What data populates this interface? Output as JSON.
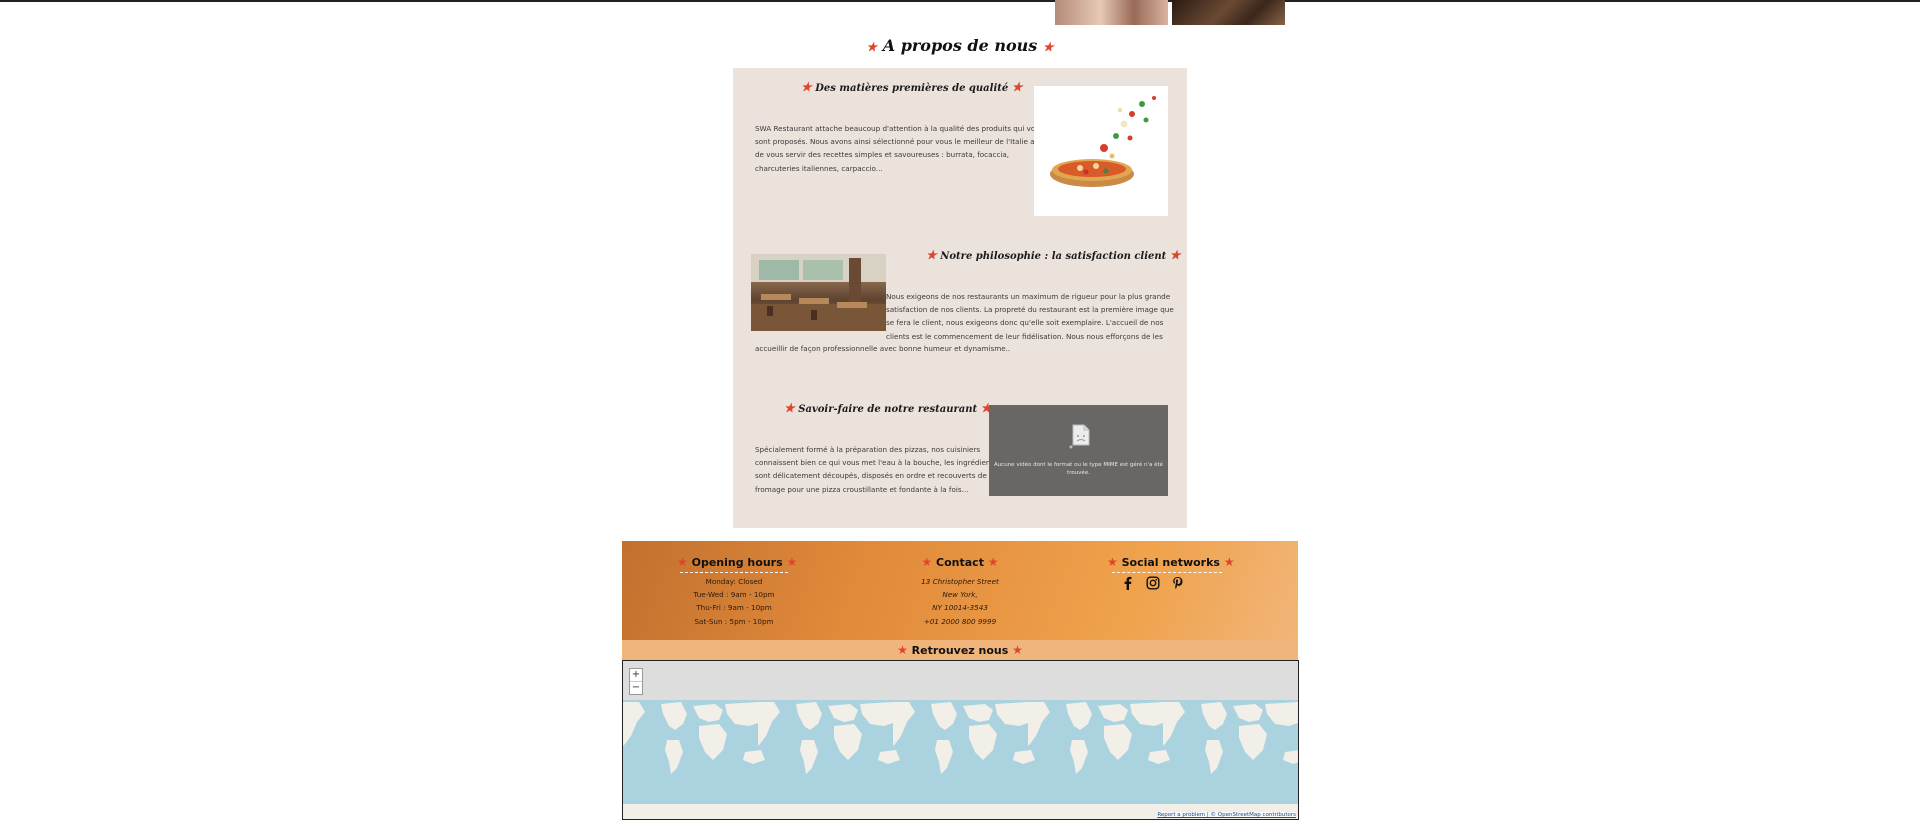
{
  "header": {
    "title": "A propos de nous"
  },
  "about": {
    "sections": [
      {
        "title": "Des matières premières de qualité",
        "lines": [
          "SWA Restaurant attache beaucoup d'attention à la qualité des produits qui vous",
          "sont proposés. Nous avons ainsi sélectionné pour vous le meilleur de l'Italie afin",
          "de vous servir des recettes simples et savoureuses : burrata, focaccia,",
          "charcuteries italiennes, carpaccio..."
        ]
      },
      {
        "title": "Notre philosophie : la satisfaction client",
        "lines": [
          "Nous exigeons de nos restaurants un maximum de rigueur pour la plus grande",
          "satisfaction de nos clients. La propreté du restaurant est la première image que",
          "se fera le client, nous exigeons donc qu'elle soit exemplaire. L'accueil de nos",
          "clients est le commencement de leur fidélisation. Nous nous efforçons de les",
          "accueillir de façon professionnelle avec bonne humeur et dynamisme.."
        ]
      },
      {
        "title": "Savoir-faire de notre restaurant",
        "lines": [
          "Spécialement formé à la préparation des pizzas, nos cuisiniers",
          "connaissent bien ce qui vous met l'eau à la bouche, les ingrédients",
          "sont délicatement découpés, disposés en ordre et recouverts de",
          "fromage pour une pizza croustillante et fondante à la fois..."
        ]
      }
    ],
    "video_error": "Aucune vidéo dont le format ou le type MIME est géré n'a été trouvée."
  },
  "footer": {
    "opening": {
      "title": "Opening hours",
      "lines": [
        "Monday: Closed",
        "Tue-Wed : 9am - 10pm",
        "Thu-Fri : 9am - 10pm",
        "Sat-Sun : 5pm - 10pm"
      ]
    },
    "contact": {
      "title": "Contact",
      "lines": [
        "13 Christopher Street",
        "New York,",
        "NY 10014-3543",
        "+01 2000 800 9999"
      ]
    },
    "social": {
      "title": "Social networks",
      "icons": [
        "facebook-icon",
        "instagram-icon",
        "pinterest-icon"
      ]
    }
  },
  "map": {
    "title": "Retrouvez nous",
    "zoom_in": "+",
    "zoom_out": "−",
    "attribution": "Report a problem | © OpenStreetMap contributors"
  },
  "colors": {
    "accent_star": "#e0452b",
    "about_bg": "#ebe2dc",
    "footer_start": "#c2702f",
    "footer_end": "#f1b579",
    "ocean": "#aad3df",
    "land": "#f2efe9"
  }
}
